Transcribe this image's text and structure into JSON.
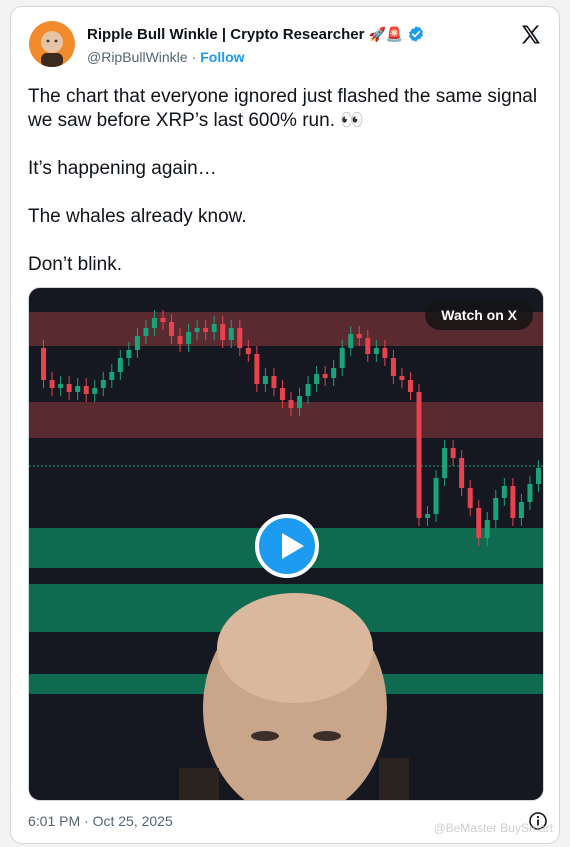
{
  "author": {
    "display_name": "Ripple Bull Winkle | Crypto Researcher",
    "emoji_suffix": "🚀🚨",
    "handle": "@RipBullWinkle",
    "separator": "·",
    "follow_label": "Follow",
    "verified_icon": "verified-badge-icon"
  },
  "tweet": {
    "paragraphs": [
      "The chart that everyone ignored just flashed the same signal we saw before XRP’s last 600% run. 👀",
      "It’s happening again…",
      "The whales already know.",
      "Don’t blink."
    ]
  },
  "media": {
    "watch_label": "Watch on X",
    "play_icon": "play-icon"
  },
  "footer": {
    "timestamp": "6:01 PM · Oct 25, 2025",
    "info_icon": "info-icon",
    "watermark": "@BeMaster BuySmart"
  },
  "colors": {
    "accent": "#1d9bf0",
    "bull": "#1aa378",
    "bear": "#e8424e",
    "chart_bg": "#151821",
    "avatar_bg": "#f28b2c"
  }
}
